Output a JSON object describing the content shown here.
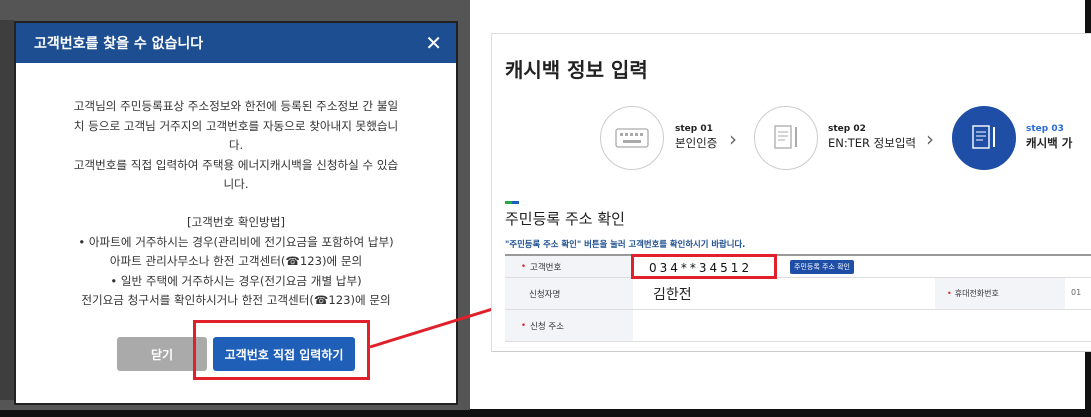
{
  "modal": {
    "title": "고객번호를 찾을 수 없습니다",
    "close_icon": "close-icon",
    "message_lines": [
      "고객님의 주민등록표상 주소정보와 한전에 등록된 주소정보 간 불일",
      "치 등으로 고객님 거주지의 고객번호를 자동으로 찾아내지 못했습니",
      "다.",
      "고객번호를 직접 입력하여 주택용 에너지캐시백을 신청하실 수 있습",
      "니다."
    ],
    "howto_title": "[고객번호 확인방법]",
    "howto_lines": [
      "• 아파트에 거주하시는 경우(관리비에 전기요금을 포함하여 납부)",
      "아파트 관리사무소나 한전 고객센터(☎123)에 문의",
      "• 일반 주택에 거주하시는 경우(전기요금 개별 납부)",
      "전기요금 청구서를 확인하시거나 한전 고객센터(☎123)에 문의"
    ],
    "close_label": "닫기",
    "direct_label": "고객번호 직접 입력하기"
  },
  "page": {
    "title": "캐시백 정보 입력",
    "steps": [
      {
        "num": "step 01",
        "name": "본인인증",
        "icon": "keyboard-icon"
      },
      {
        "num": "step 02",
        "name": "EN:TER 정보입력",
        "icon": "document-pen-icon"
      },
      {
        "num": "step 03",
        "name": "캐시백 가",
        "icon": "document-pen-icon"
      }
    ],
    "section_title": "주민등록 주소 확인",
    "notice": "\"주민등록 주소 확인\" 버튼을 눌러 고객번호를 확인하시기 바랍니다.",
    "rows": {
      "customer_label": "고객번호",
      "customer_value": "034**34512",
      "address_button": "주민등록 주소 확인",
      "applicant_label": "신청자명",
      "applicant_value": "김한전",
      "phone_label": "휴대전화번호",
      "phone_value": "01",
      "address_label": "신청 주소"
    }
  },
  "colors": {
    "header_blue": "#1d4e91",
    "button_blue": "#1f5fb8",
    "highlight_red": "#e0202a"
  }
}
